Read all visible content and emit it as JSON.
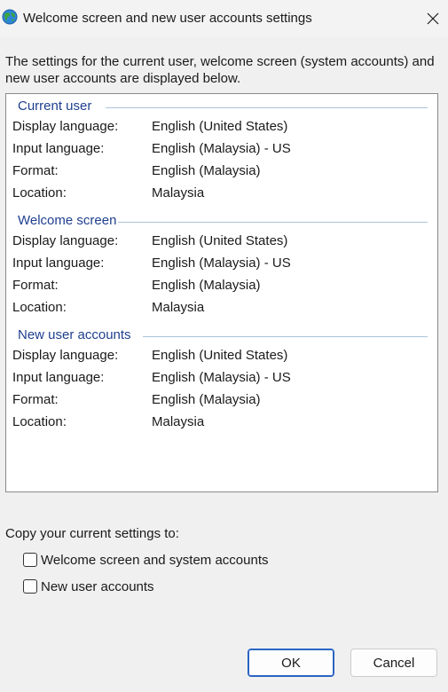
{
  "window": {
    "title": "Welcome screen and new user accounts settings",
    "icon": "globe-icon",
    "close_icon": "close-icon"
  },
  "intro": "The settings for the current user, welcome screen (system accounts) and new user accounts are displayed below.",
  "sections": [
    {
      "title": "Current user",
      "rows": [
        {
          "label": "Display language:",
          "value": "English (United States)"
        },
        {
          "label": "Input language:",
          "value": "English (Malaysia) - US"
        },
        {
          "label": "Format:",
          "value": "English (Malaysia)"
        },
        {
          "label": "Location:",
          "value": "Malaysia"
        }
      ]
    },
    {
      "title": "Welcome screen",
      "rows": [
        {
          "label": "Display language:",
          "value": "English (United States)"
        },
        {
          "label": "Input language:",
          "value": "English (Malaysia) - US"
        },
        {
          "label": "Format:",
          "value": "English (Malaysia)"
        },
        {
          "label": "Location:",
          "value": "Malaysia"
        }
      ]
    },
    {
      "title": "New user accounts",
      "rows": [
        {
          "label": "Display language:",
          "value": "English (United States)"
        },
        {
          "label": "Input language:",
          "value": "English (Malaysia) - US"
        },
        {
          "label": "Format:",
          "value": "English (Malaysia)"
        },
        {
          "label": "Location:",
          "value": "Malaysia"
        }
      ]
    }
  ],
  "copy": {
    "label": "Copy your current settings to:",
    "options": [
      {
        "label": "Welcome screen and system accounts",
        "checked": false
      },
      {
        "label": "New user accounts",
        "checked": false
      }
    ]
  },
  "buttons": {
    "ok": "OK",
    "cancel": "Cancel"
  },
  "colors": {
    "section_title": "#1f3f8f",
    "section_rule": "#a9c4dc",
    "ok_border": "#2a64c4"
  }
}
